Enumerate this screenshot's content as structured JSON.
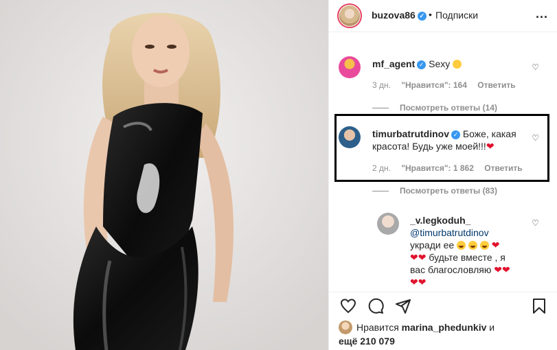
{
  "header": {
    "username": "buzova86",
    "dot": "•",
    "follow_label": "Подписки",
    "more": "..."
  },
  "comments": [
    {
      "username": "mf_agent",
      "text": "Sexy",
      "time": "3 дн.",
      "likes": "\"Нравится\": 164",
      "reply": "Ответить",
      "view_replies": "Посмотреть ответы (14)"
    },
    {
      "username": "timurbatrutdinov",
      "text_line1": "Боже, какая",
      "text_line2": "красота! Будь уже моей!!!",
      "time": "2 дн.",
      "likes": "\"Нравится\": 1 862",
      "reply": "Ответить",
      "view_replies": "Посмотреть ответы (83)"
    },
    {
      "username": "_v.legkoduh_",
      "mention": "@timurbatrutdinov",
      "line1": "укради ее",
      "line2": "будьте вместе , я",
      "line3": "вас благословляю"
    }
  ],
  "likes_summary": {
    "prefix": "Нравится",
    "user": "marina_phedunkiv",
    "suffix": "и",
    "others": "ещё 210 079"
  },
  "icons": [
    "verified-icon",
    "heart-icon",
    "comment-icon",
    "share-icon",
    "bookmark-icon",
    "more-icon"
  ],
  "colors": {
    "verified": "#3897f0",
    "heart_red": "#e0132d",
    "muted": "#8e8e8e",
    "text": "#262626"
  }
}
